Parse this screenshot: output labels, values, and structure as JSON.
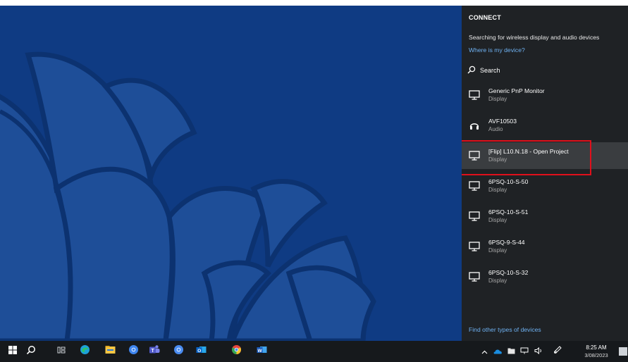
{
  "connect_panel": {
    "title": "CONNECT",
    "status": "Searching for wireless display and audio devices",
    "where_link": "Where is my device?",
    "search_label": "Search",
    "devices": [
      {
        "name": "Generic PnP Monitor",
        "type": "Display",
        "icon": "monitor-icon"
      },
      {
        "name": "AVF10503",
        "type": "Audio",
        "icon": "headphones-icon"
      },
      {
        "name": "[Flip] L10.N.18 - Open Project",
        "type": "Display",
        "icon": "monitor-icon",
        "selected": true
      },
      {
        "name": "6PSQ-10-S-50",
        "type": "Display",
        "icon": "monitor-icon"
      },
      {
        "name": "6PSQ-10-S-51",
        "type": "Display",
        "icon": "monitor-icon"
      },
      {
        "name": "6PSQ-9-S-44",
        "type": "Display",
        "icon": "monitor-icon"
      },
      {
        "name": "6PSQ-10-S-32",
        "type": "Display",
        "icon": "monitor-icon"
      }
    ],
    "find_other_link": "Find other types of devices"
  },
  "taskbar": {
    "icons": [
      "windows-start-icon",
      "search-icon",
      "task-view-icon",
      "edge-icon",
      "file-explorer-icon",
      "chrome-canary-icon",
      "teams-icon",
      "chrome-icon",
      "outlook-icon",
      "chrome-alt-icon",
      "word-icon"
    ],
    "tray_icons": [
      "chevron-up-icon",
      "onedrive-icon",
      "folder-icon",
      "network-icon",
      "volume-icon",
      "pen-icon"
    ],
    "time": "8:25 AM",
    "date": "3/08/2023"
  },
  "colors": {
    "desktop_blue": "#0f3b83",
    "panel_bg": "#1f2225",
    "link_blue": "#6fb2f2",
    "highlight_red": "#e0101b",
    "taskbar_bg": "#16191c"
  }
}
